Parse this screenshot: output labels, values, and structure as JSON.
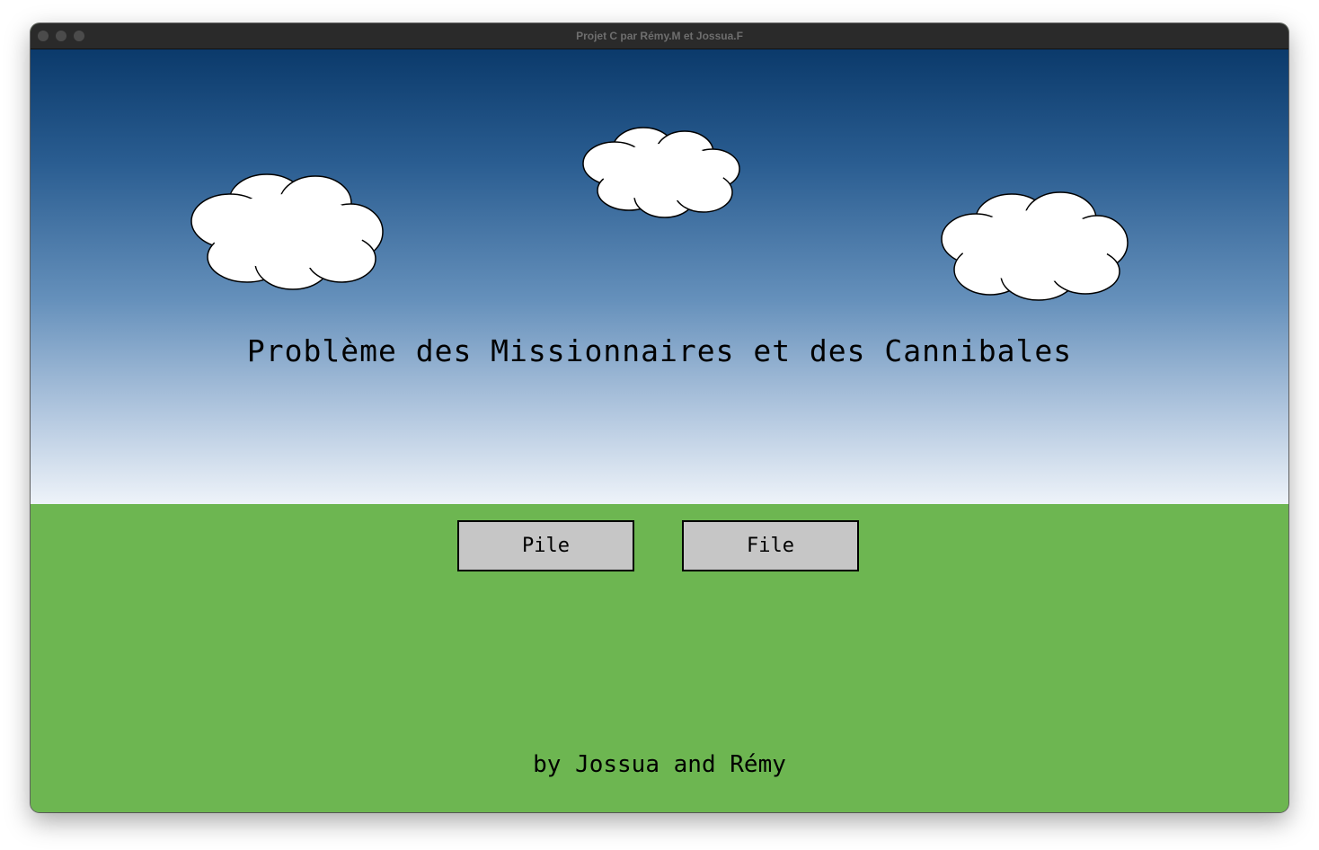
{
  "window": {
    "title": "Projet C par Rémy.M et Jossua.F"
  },
  "game": {
    "title": "Problème des Missionnaires et des Cannibales",
    "buttons": {
      "pile_label": "Pile",
      "file_label": "File"
    },
    "credits": "by Jossua and Rémy"
  },
  "colors": {
    "sky_top": "#0b3a6b",
    "sky_bottom": "#eef3f9",
    "ground": "#6db651",
    "button_bg": "#c6c6c6",
    "cloud": "#ffffff"
  }
}
